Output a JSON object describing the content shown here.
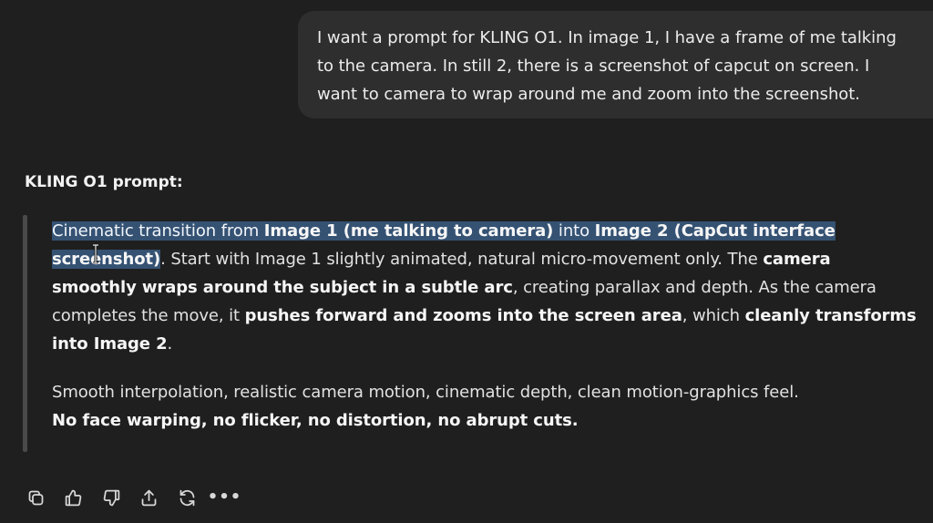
{
  "user_message": {
    "lines": [
      "I want a prompt for KLING O1. In image 1, I have a frame of me talking",
      "to the camera. In still 2, there is a screenshot of capcut on screen. I",
      "want to camera to wrap around me and zoom into the screenshot."
    ]
  },
  "response": {
    "heading": "KLING O1 prompt:",
    "paragraph1": {
      "line1": {
        "t1": "Cinematic transition from ",
        "t2": "Image 1 (me talking to camera)",
        "t3": " into ",
        "t4": "Image 2 (CapCut interface"
      },
      "line2": {
        "t1": "screenshot)",
        "t2": ". Start with Image 1 slightly animated, natural micro-movement only. The ",
        "t3": "camera"
      },
      "line3": {
        "t1": "smoothly wraps around the subject in a subtle arc",
        "t2": ", creating parallax and depth. As the camera"
      },
      "line4": {
        "t1": "completes the move, it ",
        "t2": "pushes forward and zooms into the screen area",
        "t3": ", which ",
        "t4": "cleanly transforms"
      },
      "line5": {
        "t1": "into Image 2",
        "t2": "."
      }
    },
    "paragraph2": {
      "line1": "Smooth interpolation, realistic camera motion, cinematic depth, clean motion-graphics feel.",
      "line2": "No face warping, no flicker, no distortion, no abrupt cuts."
    }
  },
  "toolbar": {
    "icons": [
      "copy-icon",
      "thumbs-up-icon",
      "thumbs-down-icon",
      "share-icon",
      "regenerate-icon",
      "more-icon"
    ],
    "more_label": "•••"
  },
  "colors": {
    "background": "#1f1f1f",
    "bubble": "#2e2e2e",
    "selection": "#355273",
    "quote_bar": "#4a4a4a"
  }
}
